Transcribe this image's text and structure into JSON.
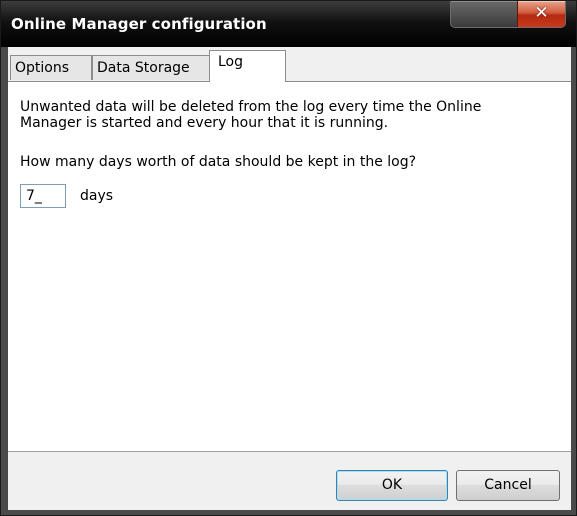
{
  "window": {
    "title": "Online Manager configuration",
    "close_glyph": "✕"
  },
  "tabs": [
    {
      "label": "Options",
      "active": false
    },
    {
      "label": "Data Storage",
      "active": false
    },
    {
      "label": "Log",
      "active": true
    }
  ],
  "log_tab": {
    "description": "Unwanted data will be deleted from the log every time the Online Manager is started and every hour that it is running.",
    "question": "How many days worth of data should be kept in the log?",
    "days_value": "7_",
    "days_label": "days"
  },
  "buttons": {
    "ok": "OK",
    "cancel": "Cancel"
  },
  "colors": {
    "titlebar": "#000000",
    "close_button": "#c9391c",
    "dialog_background": "#f0f0f0",
    "panel_background": "#ffffff"
  },
  "icons": {
    "close": "close-icon"
  }
}
